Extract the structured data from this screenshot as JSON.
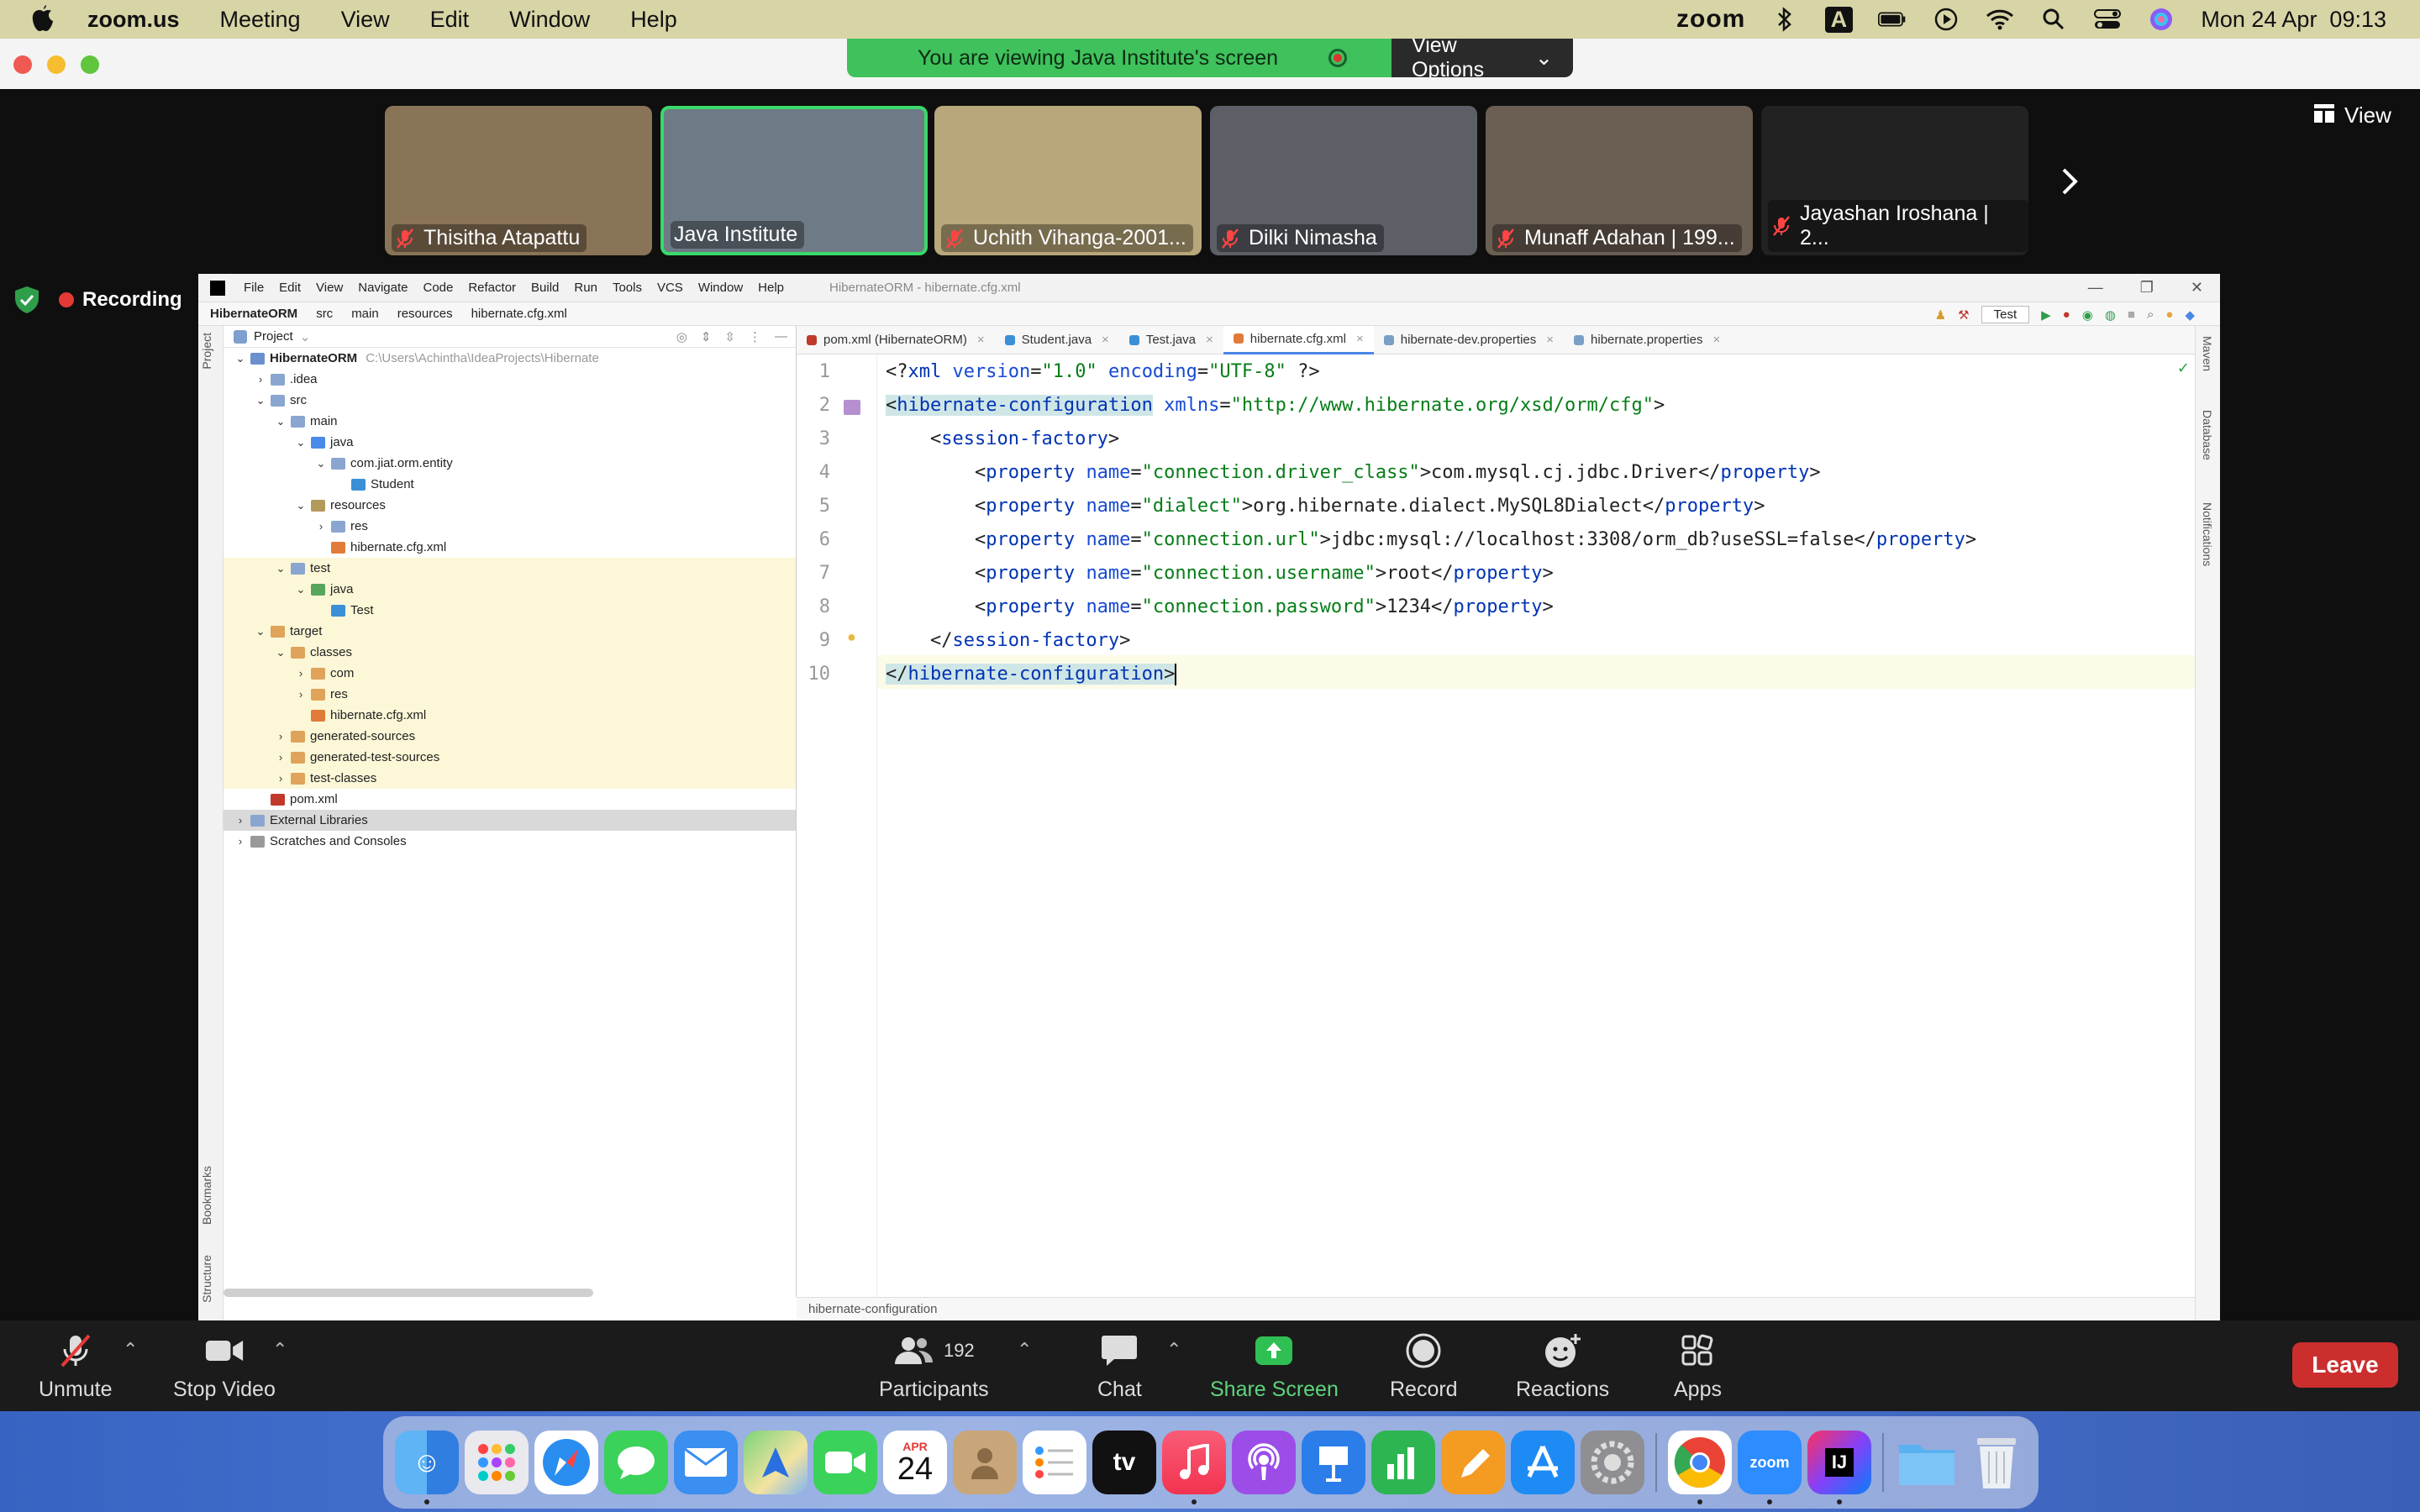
{
  "menubar": {
    "app": "zoom.us",
    "items": [
      "Meeting",
      "View",
      "Edit",
      "Window",
      "Help"
    ],
    "zoom_label": "zoom",
    "input_source": "A",
    "datetime": "Mon 24 Apr  09:13"
  },
  "share_banner": {
    "text": "You are viewing Java Institute's screen",
    "view_options": "View Options"
  },
  "participants": [
    {
      "name": "Thisitha Atapattu",
      "muted": true,
      "bg": "#8a7458"
    },
    {
      "name": "Java Institute",
      "muted": false,
      "bg": "#6e7a86"
    },
    {
      "name": "Uchith Vihanga-2001...",
      "muted": true,
      "bg": "#b8a77a"
    },
    {
      "name": "Dilki Nimasha",
      "muted": true,
      "bg": "#5c5f66"
    },
    {
      "name": "Munaff Adahan | 199...",
      "muted": true,
      "bg": "#6b5e52"
    },
    {
      "name": "Jayashan Iroshana | 2...",
      "muted": true,
      "bg": "#222222"
    }
  ],
  "view_button": "View",
  "recording_label": "Recording",
  "ide": {
    "menu": [
      "File",
      "Edit",
      "View",
      "Navigate",
      "Code",
      "Refactor",
      "Build",
      "Run",
      "Tools",
      "VCS",
      "Window",
      "Help"
    ],
    "window_title": "HibernateORM - hibernate.cfg.xml",
    "breadcrumb": [
      "HibernateORM",
      "src",
      "main",
      "resources",
      "hibernate.cfg.xml"
    ],
    "run_config": "Test",
    "project_header": "Project",
    "tree": [
      {
        "label": "HibernateORM",
        "path": "C:\\Users\\Achintha\\IdeaProjects\\Hibernate",
        "depth": 0,
        "arrow": "v",
        "icon": "#6b8fcf",
        "bold": true
      },
      {
        "label": ".idea",
        "depth": 1,
        "arrow": ">",
        "icon": "#8aa5cf"
      },
      {
        "label": "src",
        "depth": 1,
        "arrow": "v",
        "icon": "#8aa5cf"
      },
      {
        "label": "main",
        "depth": 2,
        "arrow": "v",
        "icon": "#8aa5cf"
      },
      {
        "label": "java",
        "depth": 3,
        "arrow": "v",
        "icon": "#4a8ae8"
      },
      {
        "label": "com.jiat.orm.entity",
        "depth": 4,
        "arrow": "v",
        "icon": "#8aa5cf"
      },
      {
        "label": "Student",
        "depth": 5,
        "arrow": "",
        "icon": "#3b8fd6"
      },
      {
        "label": "resources",
        "depth": 3,
        "arrow": "v",
        "icon": "#b39a5a"
      },
      {
        "label": "res",
        "depth": 4,
        "arrow": ">",
        "icon": "#8aa5cf"
      },
      {
        "label": "hibernate.cfg.xml",
        "depth": 4,
        "arrow": "",
        "icon": "#e07b39"
      },
      {
        "label": "test",
        "depth": 2,
        "arrow": "v",
        "icon": "#8aa5cf",
        "hl": true
      },
      {
        "label": "java",
        "depth": 3,
        "arrow": "v",
        "icon": "#58a65c",
        "hl": true
      },
      {
        "label": "Test",
        "depth": 4,
        "arrow": "",
        "icon": "#3b8fd6",
        "hl": true
      },
      {
        "label": "target",
        "depth": 1,
        "arrow": "v",
        "icon": "#e0a35a",
        "hl": true
      },
      {
        "label": "classes",
        "depth": 2,
        "arrow": "v",
        "icon": "#e0a35a",
        "hl": true
      },
      {
        "label": "com",
        "depth": 3,
        "arrow": ">",
        "icon": "#e0a35a",
        "hl": true
      },
      {
        "label": "res",
        "depth": 3,
        "arrow": ">",
        "icon": "#e0a35a",
        "hl": true
      },
      {
        "label": "hibernate.cfg.xml",
        "depth": 3,
        "arrow": "",
        "icon": "#e07b39",
        "hl": true
      },
      {
        "label": "generated-sources",
        "depth": 2,
        "arrow": ">",
        "icon": "#e0a35a",
        "hl": true
      },
      {
        "label": "generated-test-sources",
        "depth": 2,
        "arrow": ">",
        "icon": "#e0a35a",
        "hl": true
      },
      {
        "label": "test-classes",
        "depth": 2,
        "arrow": ">",
        "icon": "#e0a35a",
        "hl": true
      },
      {
        "label": "pom.xml",
        "depth": 1,
        "arrow": "",
        "icon": "#c0392b"
      },
      {
        "label": "External Libraries",
        "depth": 0,
        "arrow": ">",
        "icon": "#8aa5cf",
        "sel": true
      },
      {
        "label": "Scratches and Consoles",
        "depth": 0,
        "arrow": ">",
        "icon": "#999999"
      }
    ],
    "tabs": [
      {
        "label": "pom.xml (HibernateORM)",
        "icon": "#c0392b"
      },
      {
        "label": "Student.java",
        "icon": "#3b8fd6"
      },
      {
        "label": "Test.java",
        "icon": "#3b8fd6"
      },
      {
        "label": "hibernate.cfg.xml",
        "icon": "#e07b39",
        "active": true
      },
      {
        "label": "hibernate-dev.properties",
        "icon": "#7aa0c8"
      },
      {
        "label": "hibernate.properties",
        "icon": "#7aa0c8"
      }
    ],
    "code_lines": [
      "<?xml version=\"1.0\" encoding=\"UTF-8\" ?>",
      "<hibernate-configuration xmlns=\"http://www.hibernate.org/xsd/orm/cfg\">",
      "    <session-factory>",
      "        <property name=\"connection.driver_class\">com.mysql.cj.jdbc.Driver</property>",
      "        <property name=\"dialect\">org.hibernate.dialect.MySQL8Dialect</property>",
      "        <property name=\"connection.url\">jdbc:mysql://localhost:3308/orm_db?useSSL=false</property>",
      "        <property name=\"connection.username\">root</property>",
      "        <property name=\"connection.password\">1234</property>",
      "    </session-factory>",
      "</hibernate-configuration>"
    ],
    "status_breadcrumb": "hibernate-configuration",
    "left_strip": [
      "Project",
      "Bookmarks",
      "Structure"
    ],
    "right_strip": [
      "Maven",
      "Database",
      "Notifications"
    ]
  },
  "toolbar": {
    "unmute": "Unmute",
    "stop_video": "Stop Video",
    "participants": "Participants",
    "participants_count": "192",
    "chat": "Chat",
    "share_screen": "Share Screen",
    "record": "Record",
    "reactions": "Reactions",
    "apps": "Apps",
    "leave": "Leave"
  },
  "dock": {
    "calendar_month": "APR",
    "calendar_day": "24",
    "tv_label": "tv",
    "zoom_label": "zoom",
    "ij_label": "IJ"
  }
}
